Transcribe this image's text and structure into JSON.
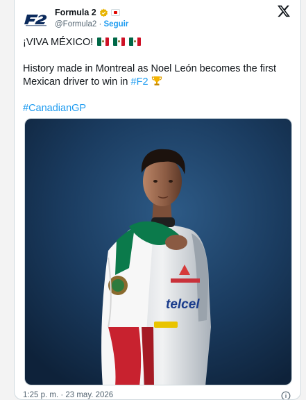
{
  "account": {
    "display_name": "Formula 2",
    "handle": "@Formula2",
    "separator": "·",
    "follow_label": "Seguir",
    "logo_icon": "f2-logo-icon",
    "verified_icon": "gold-verified-badge-icon"
  },
  "tweet": {
    "line1": "¡VIVA MÉXICO!",
    "line2": "History made in Montreal as Noel León becomes the first Mexican driver to win in",
    "hashtag_f2": "#F2",
    "hashtag_gp": "#CanadianGP"
  },
  "footer": {
    "timestamp": "1:25 p. m. · 23 may. 2026"
  },
  "colors": {
    "accent": "#1d9bf0",
    "text": "#0f1419",
    "muted": "#536471",
    "photo_bg": "#1b3a5c",
    "flag_green": "#006847",
    "flag_red": "#ce1126"
  }
}
